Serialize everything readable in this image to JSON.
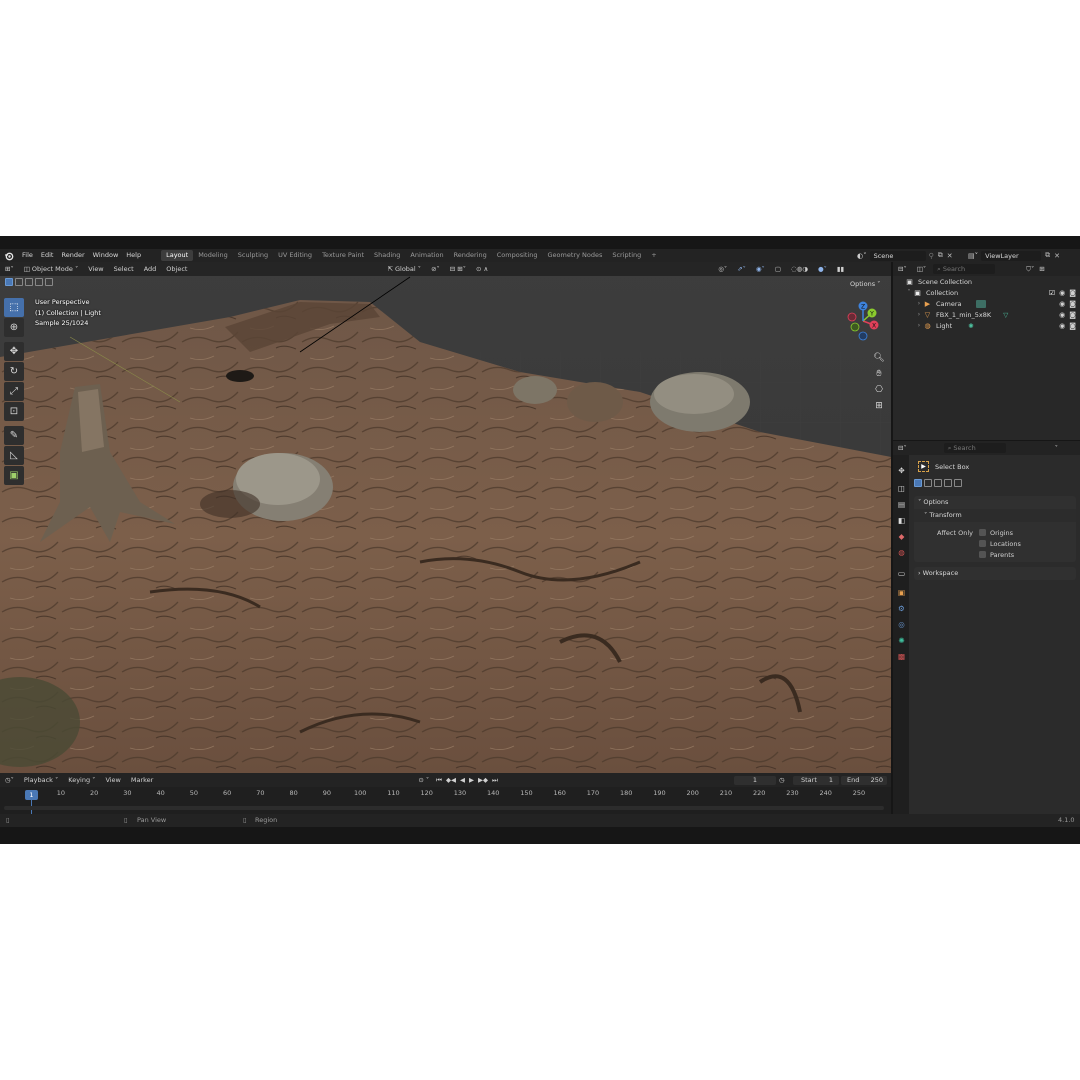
{
  "menu": {
    "items": [
      "File",
      "Edit",
      "Render",
      "Window",
      "Help"
    ],
    "workspaces": [
      "Layout",
      "Modeling",
      "Sculpting",
      "UV Editing",
      "Texture Paint",
      "Shading",
      "Animation",
      "Rendering",
      "Compositing",
      "Geometry Nodes",
      "Scripting"
    ],
    "active_workspace": "Layout",
    "add_tab": "+",
    "scene": "Scene",
    "view_layer": "ViewLayer"
  },
  "viewport": {
    "mode": "Object Mode",
    "menus": [
      "View",
      "Select",
      "Add",
      "Object"
    ],
    "transform_orientation": "Global",
    "options": "Options",
    "overlay": {
      "perspective": "User Perspective",
      "collection": "(1) Collection | Light",
      "sample": "Sample 25/1024"
    },
    "gizmo": {
      "x": "X",
      "y": "Y",
      "z": "Z"
    }
  },
  "timeline": {
    "menus": [
      "Playback",
      "Keying",
      "View",
      "Marker"
    ],
    "current_frame": "1",
    "start_label": "Start",
    "start": "1",
    "end_label": "End",
    "end": "250",
    "ticks": [
      "1",
      "10",
      "20",
      "30",
      "40",
      "50",
      "60",
      "70",
      "80",
      "90",
      "100",
      "110",
      "120",
      "130",
      "140",
      "150",
      "160",
      "170",
      "180",
      "190",
      "200",
      "210",
      "220",
      "230",
      "240",
      "250"
    ]
  },
  "status": {
    "pan_view": "Pan View",
    "region": "Region",
    "version": "4.1.0"
  },
  "outliner": {
    "search_placeholder": "Search",
    "scene_collection": "Scene Collection",
    "collection": "Collection",
    "items": [
      "Camera",
      "FBX_1_min_5x8K",
      "Light"
    ]
  },
  "properties": {
    "search_placeholder": "Search",
    "tool_name": "Select Box",
    "options": "Options",
    "transform": "Transform",
    "affect_only": "Affect Only",
    "checks": [
      "Origins",
      "Locations",
      "Parents"
    ],
    "workspace": "Workspace"
  },
  "colors": {
    "accent": "#4a78b5",
    "axis_x": "#e0405a",
    "axis_y": "#8acb2e",
    "axis_z": "#3d82dc",
    "ground": "#7a5e48"
  }
}
